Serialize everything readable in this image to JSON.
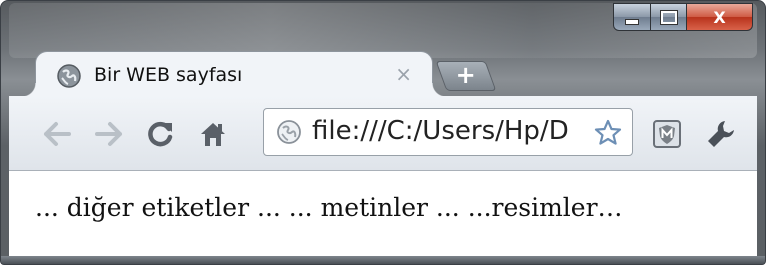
{
  "window": {
    "controls": {
      "minimize_icon": "minimize-icon",
      "maximize_icon": "maximize-icon",
      "close_glyph": "X"
    }
  },
  "tab": {
    "title": "Bir WEB sayfası",
    "close_glyph": "×",
    "favicon": "globe-icon"
  },
  "new_tab": {
    "glyph": "+"
  },
  "toolbar": {
    "back_icon": "back-arrow-icon",
    "forward_icon": "forward-arrow-icon",
    "reload_icon": "reload-icon",
    "home_icon": "home-icon",
    "url": "file:///C:/Users/Hp/D",
    "page_icon": "globe-icon",
    "bookmark_icon": "star-icon",
    "extension_icon": "shield-m-icon",
    "settings_icon": "wrench-icon"
  },
  "content": {
    "text": "... diğer etiketler ... ... metinler ... ...resimler…"
  },
  "colors": {
    "frame": "#5b6064",
    "toolbar": "#e6eaef",
    "close_red": "#c8412a",
    "icon_gray": "#5a6068"
  }
}
